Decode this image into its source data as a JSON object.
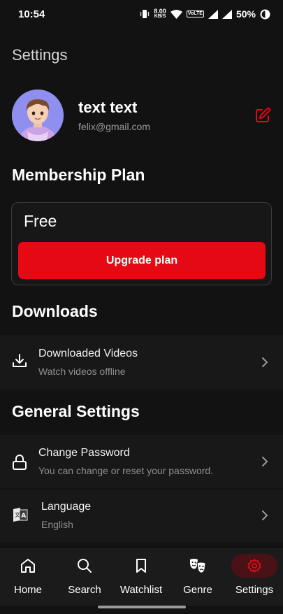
{
  "status_bar": {
    "time": "10:54",
    "speed_value": "8.00",
    "speed_unit": "KB/S",
    "volte": "VoLTE",
    "battery": "50%"
  },
  "page": {
    "title": "Settings"
  },
  "profile": {
    "name": "text text",
    "email": "felix@gmail.com"
  },
  "membership": {
    "heading": "Membership Plan",
    "plan_name": "Free",
    "upgrade_label": "Upgrade plan"
  },
  "downloads": {
    "heading": "Downloads",
    "item": {
      "title": "Downloaded Videos",
      "subtitle": "Watch videos offline"
    }
  },
  "general": {
    "heading": "General Settings",
    "items": [
      {
        "title": "Change Password",
        "subtitle": "You can change or reset your password."
      },
      {
        "title": "Language",
        "subtitle": "English"
      }
    ]
  },
  "bottom_nav": {
    "items": [
      {
        "label": "Home",
        "icon": "home-icon"
      },
      {
        "label": "Search",
        "icon": "search-icon"
      },
      {
        "label": "Watchlist",
        "icon": "bookmark-icon"
      },
      {
        "label": "Genre",
        "icon": "theater-masks-icon"
      },
      {
        "label": "Settings",
        "icon": "gear-icon",
        "active": true
      }
    ]
  },
  "colors": {
    "accent": "#e50914",
    "background": "#121212",
    "surface": "#181818"
  }
}
